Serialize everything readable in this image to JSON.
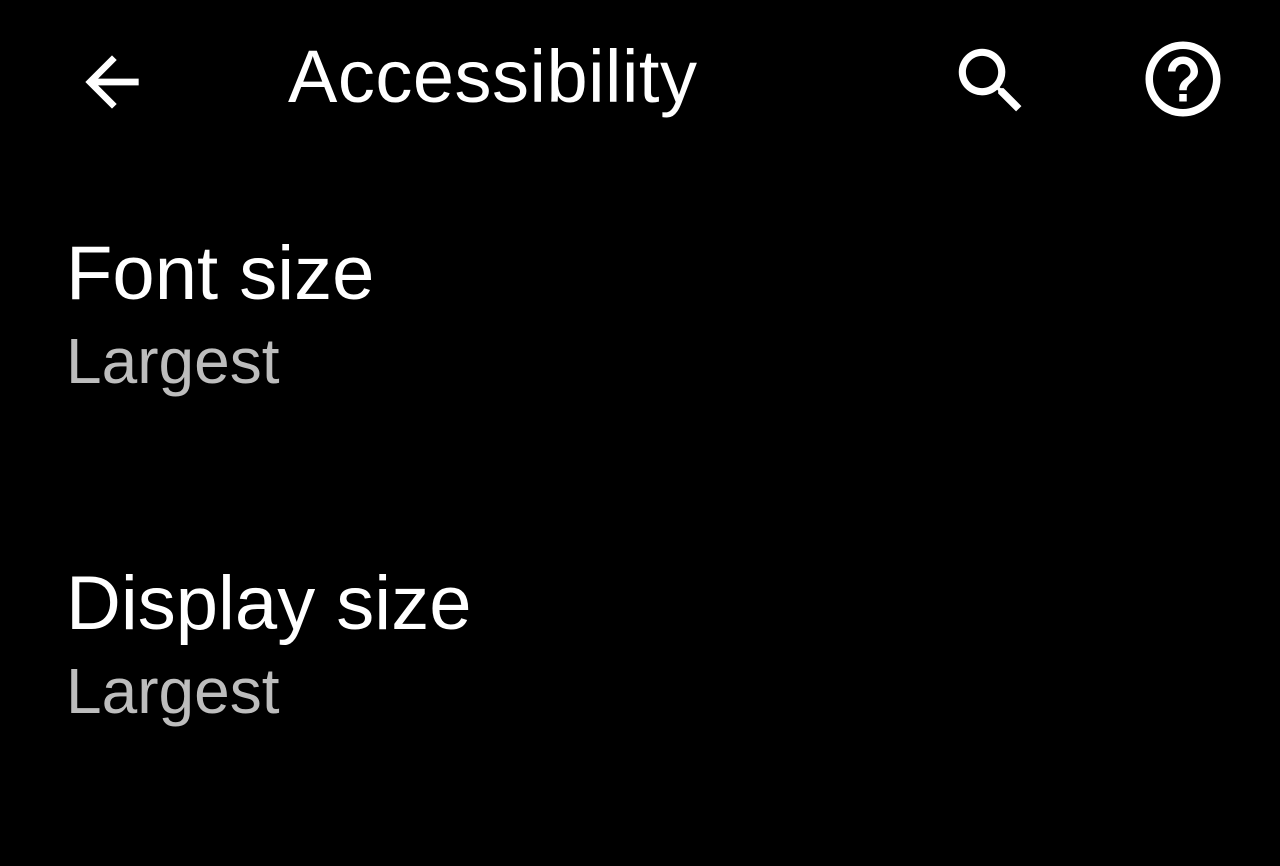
{
  "header": {
    "title": "Accessibility",
    "back_icon": "arrow-back-icon",
    "search_icon": "search-icon",
    "help_icon": "help-circle-icon"
  },
  "settings": [
    {
      "title": "Font size",
      "summary": "Largest"
    },
    {
      "title": "Display size",
      "summary": "Largest"
    }
  ],
  "colors": {
    "background": "#000000",
    "title_text": "#ffffff",
    "summary_text": "#bdbdbd"
  }
}
